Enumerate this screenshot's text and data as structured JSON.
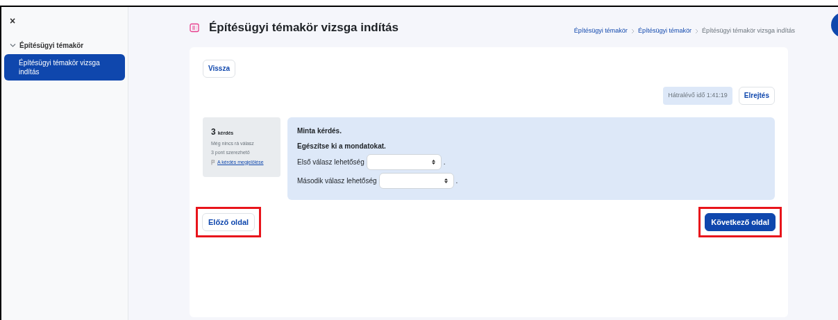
{
  "sidebar": {
    "close": "×",
    "section": {
      "label": "Építésügyi témakör",
      "expanded": true,
      "items": [
        {
          "label": "Építésügyi témakör vizsga indítás",
          "selected": true
        }
      ]
    }
  },
  "header": {
    "title": "Építésügyi témakör vizsga indítás",
    "breadcrumb": [
      {
        "label": "Építésügyi témakör",
        "current": false
      },
      {
        "label": "Építésügyi témakör",
        "current": false
      },
      {
        "label": "Építésügyi témakör vizsga indítás",
        "current": true
      }
    ]
  },
  "back_button": "Vissza",
  "timer": "Hátralévő idő 1:41:19",
  "hide_button": "Elrejtés",
  "question_info": {
    "number": "3",
    "number_label": "kérdés",
    "status": "Még nincs rá válasz",
    "points": "3 pont szerezhető",
    "flag_link": "A kérdés megjelölése"
  },
  "question": {
    "title": "Minta kérdés.",
    "instruction": "Egészítse ki a mondatokat.",
    "answers": [
      {
        "label": "Első válasz lehetőség",
        "suffix": "."
      },
      {
        "label": "Második válasz lehetőség",
        "suffix": "."
      }
    ]
  },
  "nav": [
    {
      "label": "Előző oldal",
      "kind": "secondary",
      "highlighted": true
    },
    {
      "label": "Következő oldal",
      "kind": "primary",
      "highlighted": true
    }
  ]
}
